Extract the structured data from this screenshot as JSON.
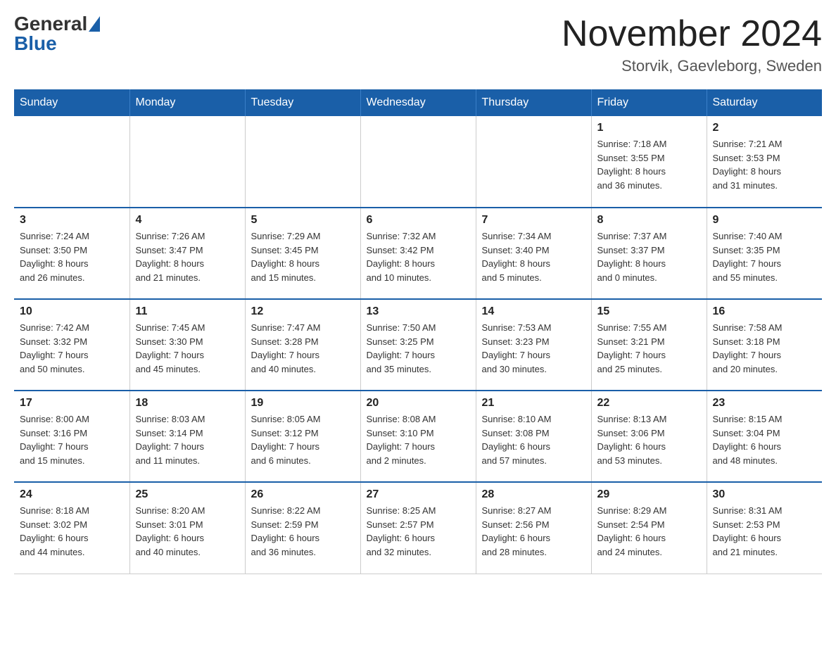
{
  "header": {
    "logo_general": "General",
    "logo_blue": "Blue",
    "month_title": "November 2024",
    "location": "Storvik, Gaevleborg, Sweden"
  },
  "weekdays": [
    "Sunday",
    "Monday",
    "Tuesday",
    "Wednesday",
    "Thursday",
    "Friday",
    "Saturday"
  ],
  "weeks": [
    [
      {
        "day": "",
        "info": ""
      },
      {
        "day": "",
        "info": ""
      },
      {
        "day": "",
        "info": ""
      },
      {
        "day": "",
        "info": ""
      },
      {
        "day": "",
        "info": ""
      },
      {
        "day": "1",
        "info": "Sunrise: 7:18 AM\nSunset: 3:55 PM\nDaylight: 8 hours\nand 36 minutes."
      },
      {
        "day": "2",
        "info": "Sunrise: 7:21 AM\nSunset: 3:53 PM\nDaylight: 8 hours\nand 31 minutes."
      }
    ],
    [
      {
        "day": "3",
        "info": "Sunrise: 7:24 AM\nSunset: 3:50 PM\nDaylight: 8 hours\nand 26 minutes."
      },
      {
        "day": "4",
        "info": "Sunrise: 7:26 AM\nSunset: 3:47 PM\nDaylight: 8 hours\nand 21 minutes."
      },
      {
        "day": "5",
        "info": "Sunrise: 7:29 AM\nSunset: 3:45 PM\nDaylight: 8 hours\nand 15 minutes."
      },
      {
        "day": "6",
        "info": "Sunrise: 7:32 AM\nSunset: 3:42 PM\nDaylight: 8 hours\nand 10 minutes."
      },
      {
        "day": "7",
        "info": "Sunrise: 7:34 AM\nSunset: 3:40 PM\nDaylight: 8 hours\nand 5 minutes."
      },
      {
        "day": "8",
        "info": "Sunrise: 7:37 AM\nSunset: 3:37 PM\nDaylight: 8 hours\nand 0 minutes."
      },
      {
        "day": "9",
        "info": "Sunrise: 7:40 AM\nSunset: 3:35 PM\nDaylight: 7 hours\nand 55 minutes."
      }
    ],
    [
      {
        "day": "10",
        "info": "Sunrise: 7:42 AM\nSunset: 3:32 PM\nDaylight: 7 hours\nand 50 minutes."
      },
      {
        "day": "11",
        "info": "Sunrise: 7:45 AM\nSunset: 3:30 PM\nDaylight: 7 hours\nand 45 minutes."
      },
      {
        "day": "12",
        "info": "Sunrise: 7:47 AM\nSunset: 3:28 PM\nDaylight: 7 hours\nand 40 minutes."
      },
      {
        "day": "13",
        "info": "Sunrise: 7:50 AM\nSunset: 3:25 PM\nDaylight: 7 hours\nand 35 minutes."
      },
      {
        "day": "14",
        "info": "Sunrise: 7:53 AM\nSunset: 3:23 PM\nDaylight: 7 hours\nand 30 minutes."
      },
      {
        "day": "15",
        "info": "Sunrise: 7:55 AM\nSunset: 3:21 PM\nDaylight: 7 hours\nand 25 minutes."
      },
      {
        "day": "16",
        "info": "Sunrise: 7:58 AM\nSunset: 3:18 PM\nDaylight: 7 hours\nand 20 minutes."
      }
    ],
    [
      {
        "day": "17",
        "info": "Sunrise: 8:00 AM\nSunset: 3:16 PM\nDaylight: 7 hours\nand 15 minutes."
      },
      {
        "day": "18",
        "info": "Sunrise: 8:03 AM\nSunset: 3:14 PM\nDaylight: 7 hours\nand 11 minutes."
      },
      {
        "day": "19",
        "info": "Sunrise: 8:05 AM\nSunset: 3:12 PM\nDaylight: 7 hours\nand 6 minutes."
      },
      {
        "day": "20",
        "info": "Sunrise: 8:08 AM\nSunset: 3:10 PM\nDaylight: 7 hours\nand 2 minutes."
      },
      {
        "day": "21",
        "info": "Sunrise: 8:10 AM\nSunset: 3:08 PM\nDaylight: 6 hours\nand 57 minutes."
      },
      {
        "day": "22",
        "info": "Sunrise: 8:13 AM\nSunset: 3:06 PM\nDaylight: 6 hours\nand 53 minutes."
      },
      {
        "day": "23",
        "info": "Sunrise: 8:15 AM\nSunset: 3:04 PM\nDaylight: 6 hours\nand 48 minutes."
      }
    ],
    [
      {
        "day": "24",
        "info": "Sunrise: 8:18 AM\nSunset: 3:02 PM\nDaylight: 6 hours\nand 44 minutes."
      },
      {
        "day": "25",
        "info": "Sunrise: 8:20 AM\nSunset: 3:01 PM\nDaylight: 6 hours\nand 40 minutes."
      },
      {
        "day": "26",
        "info": "Sunrise: 8:22 AM\nSunset: 2:59 PM\nDaylight: 6 hours\nand 36 minutes."
      },
      {
        "day": "27",
        "info": "Sunrise: 8:25 AM\nSunset: 2:57 PM\nDaylight: 6 hours\nand 32 minutes."
      },
      {
        "day": "28",
        "info": "Sunrise: 8:27 AM\nSunset: 2:56 PM\nDaylight: 6 hours\nand 28 minutes."
      },
      {
        "day": "29",
        "info": "Sunrise: 8:29 AM\nSunset: 2:54 PM\nDaylight: 6 hours\nand 24 minutes."
      },
      {
        "day": "30",
        "info": "Sunrise: 8:31 AM\nSunset: 2:53 PM\nDaylight: 6 hours\nand 21 minutes."
      }
    ]
  ]
}
